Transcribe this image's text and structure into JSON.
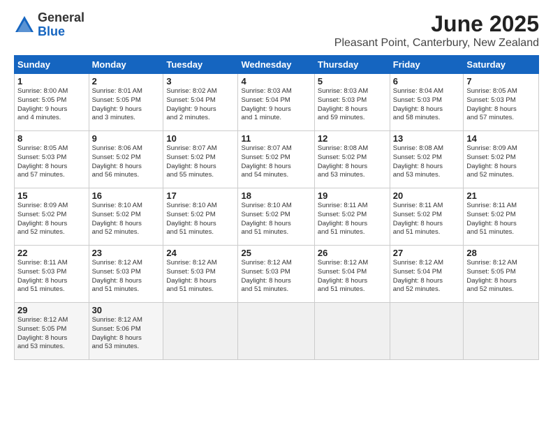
{
  "logo": {
    "general": "General",
    "blue": "Blue"
  },
  "title": "June 2025",
  "subtitle": "Pleasant Point, Canterbury, New Zealand",
  "headers": [
    "Sunday",
    "Monday",
    "Tuesday",
    "Wednesday",
    "Thursday",
    "Friday",
    "Saturday"
  ],
  "weeks": [
    [
      {
        "day": "1",
        "info": "Sunrise: 8:00 AM\nSunset: 5:05 PM\nDaylight: 9 hours\nand 4 minutes."
      },
      {
        "day": "2",
        "info": "Sunrise: 8:01 AM\nSunset: 5:05 PM\nDaylight: 9 hours\nand 3 minutes."
      },
      {
        "day": "3",
        "info": "Sunrise: 8:02 AM\nSunset: 5:04 PM\nDaylight: 9 hours\nand 2 minutes."
      },
      {
        "day": "4",
        "info": "Sunrise: 8:03 AM\nSunset: 5:04 PM\nDaylight: 9 hours\nand 1 minute."
      },
      {
        "day": "5",
        "info": "Sunrise: 8:03 AM\nSunset: 5:03 PM\nDaylight: 8 hours\nand 59 minutes."
      },
      {
        "day": "6",
        "info": "Sunrise: 8:04 AM\nSunset: 5:03 PM\nDaylight: 8 hours\nand 58 minutes."
      },
      {
        "day": "7",
        "info": "Sunrise: 8:05 AM\nSunset: 5:03 PM\nDaylight: 8 hours\nand 57 minutes."
      }
    ],
    [
      {
        "day": "8",
        "info": "Sunrise: 8:05 AM\nSunset: 5:03 PM\nDaylight: 8 hours\nand 57 minutes."
      },
      {
        "day": "9",
        "info": "Sunrise: 8:06 AM\nSunset: 5:02 PM\nDaylight: 8 hours\nand 56 minutes."
      },
      {
        "day": "10",
        "info": "Sunrise: 8:07 AM\nSunset: 5:02 PM\nDaylight: 8 hours\nand 55 minutes."
      },
      {
        "day": "11",
        "info": "Sunrise: 8:07 AM\nSunset: 5:02 PM\nDaylight: 8 hours\nand 54 minutes."
      },
      {
        "day": "12",
        "info": "Sunrise: 8:08 AM\nSunset: 5:02 PM\nDaylight: 8 hours\nand 53 minutes."
      },
      {
        "day": "13",
        "info": "Sunrise: 8:08 AM\nSunset: 5:02 PM\nDaylight: 8 hours\nand 53 minutes."
      },
      {
        "day": "14",
        "info": "Sunrise: 8:09 AM\nSunset: 5:02 PM\nDaylight: 8 hours\nand 52 minutes."
      }
    ],
    [
      {
        "day": "15",
        "info": "Sunrise: 8:09 AM\nSunset: 5:02 PM\nDaylight: 8 hours\nand 52 minutes."
      },
      {
        "day": "16",
        "info": "Sunrise: 8:10 AM\nSunset: 5:02 PM\nDaylight: 8 hours\nand 52 minutes."
      },
      {
        "day": "17",
        "info": "Sunrise: 8:10 AM\nSunset: 5:02 PM\nDaylight: 8 hours\nand 51 minutes."
      },
      {
        "day": "18",
        "info": "Sunrise: 8:10 AM\nSunset: 5:02 PM\nDaylight: 8 hours\nand 51 minutes."
      },
      {
        "day": "19",
        "info": "Sunrise: 8:11 AM\nSunset: 5:02 PM\nDaylight: 8 hours\nand 51 minutes."
      },
      {
        "day": "20",
        "info": "Sunrise: 8:11 AM\nSunset: 5:02 PM\nDaylight: 8 hours\nand 51 minutes."
      },
      {
        "day": "21",
        "info": "Sunrise: 8:11 AM\nSunset: 5:02 PM\nDaylight: 8 hours\nand 51 minutes."
      }
    ],
    [
      {
        "day": "22",
        "info": "Sunrise: 8:11 AM\nSunset: 5:03 PM\nDaylight: 8 hours\nand 51 minutes."
      },
      {
        "day": "23",
        "info": "Sunrise: 8:12 AM\nSunset: 5:03 PM\nDaylight: 8 hours\nand 51 minutes."
      },
      {
        "day": "24",
        "info": "Sunrise: 8:12 AM\nSunset: 5:03 PM\nDaylight: 8 hours\nand 51 minutes."
      },
      {
        "day": "25",
        "info": "Sunrise: 8:12 AM\nSunset: 5:03 PM\nDaylight: 8 hours\nand 51 minutes."
      },
      {
        "day": "26",
        "info": "Sunrise: 8:12 AM\nSunset: 5:04 PM\nDaylight: 8 hours\nand 51 minutes."
      },
      {
        "day": "27",
        "info": "Sunrise: 8:12 AM\nSunset: 5:04 PM\nDaylight: 8 hours\nand 52 minutes."
      },
      {
        "day": "28",
        "info": "Sunrise: 8:12 AM\nSunset: 5:05 PM\nDaylight: 8 hours\nand 52 minutes."
      }
    ],
    [
      {
        "day": "29",
        "info": "Sunrise: 8:12 AM\nSunset: 5:05 PM\nDaylight: 8 hours\nand 53 minutes."
      },
      {
        "day": "30",
        "info": "Sunrise: 8:12 AM\nSunset: 5:06 PM\nDaylight: 8 hours\nand 53 minutes."
      },
      {
        "day": "",
        "info": ""
      },
      {
        "day": "",
        "info": ""
      },
      {
        "day": "",
        "info": ""
      },
      {
        "day": "",
        "info": ""
      },
      {
        "day": "",
        "info": ""
      }
    ]
  ]
}
